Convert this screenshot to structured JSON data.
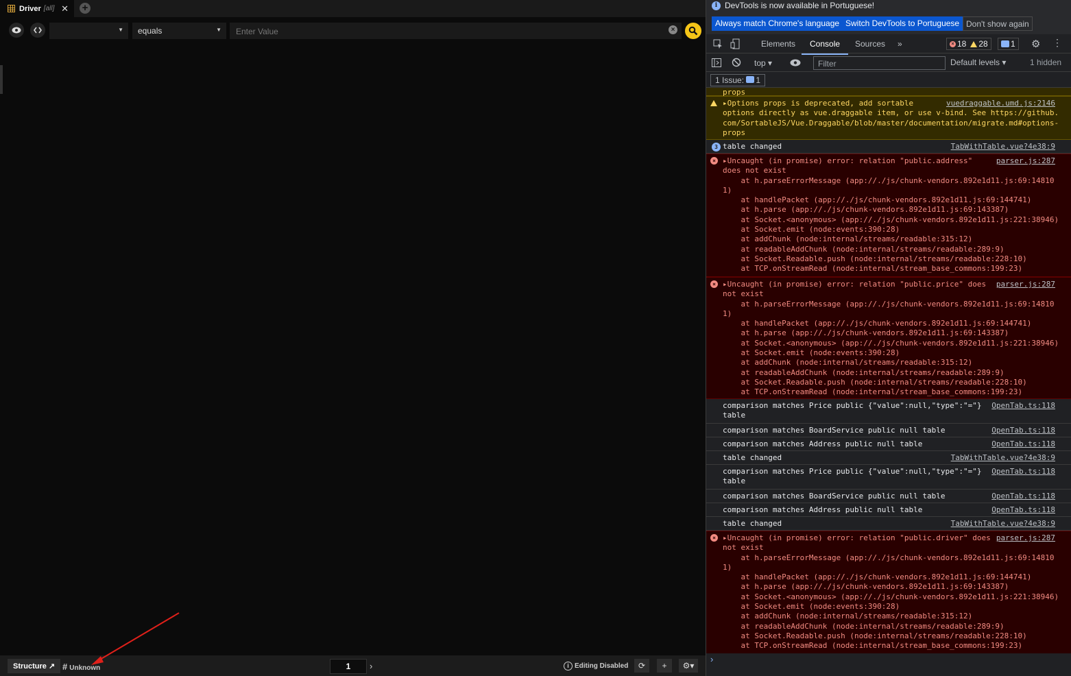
{
  "left": {
    "tab": {
      "title": "Driver",
      "scope": "[all]",
      "close": "✕",
      "add": "+"
    },
    "filter": {
      "column": "",
      "operator": "equals",
      "placeholder": "Enter Value"
    },
    "status": {
      "structure": "Structure ↗",
      "type": "Unknown",
      "page": "1",
      "editing": "Editing Disabled"
    }
  },
  "devtools": {
    "info": "DevTools is now available in Portuguese!",
    "btn_match": "Always match Chrome's language",
    "btn_switch": "Switch DevTools to Portuguese",
    "btn_dont": "Don't show again",
    "tabs": [
      "Elements",
      "Console",
      "Sources"
    ],
    "errors": "18",
    "warnings": "28",
    "messages": "1",
    "context": "top",
    "filter_placeholder": "Filter",
    "levels": "Default levels",
    "hidden": "1 hidden",
    "issues": "1 Issue:",
    "issues_count": "1",
    "rows": [
      {
        "kind": "warn-tail",
        "text": "props"
      },
      {
        "kind": "warn",
        "text": "▸Options props is deprecated, add sortable\noptions directly as vue.draggable item, or use v-bind. See https://github.\ncom/SortableJS/Vue.Draggable/blob/master/documentation/migrate.md#options-\nprops",
        "src": "vuedraggable.umd.js:2146"
      },
      {
        "kind": "log",
        "count": "3",
        "text": "table changed",
        "src": "TabWithTable.vue?4e38:9"
      },
      {
        "kind": "err",
        "text": "▸Uncaught (in promise) error: relation \"public.address\"\ndoes not exist\n    at h.parseErrorMessage (app://./js/chunk-vendors.892e1d11.js:69:14810\n1)\n    at handlePacket (app://./js/chunk-vendors.892e1d11.js:69:144741)\n    at h.parse (app://./js/chunk-vendors.892e1d11.js:69:143387)\n    at Socket.<anonymous> (app://./js/chunk-vendors.892e1d11.js:221:38946)\n    at Socket.emit (node:events:390:28)\n    at addChunk (node:internal/streams/readable:315:12)\n    at readableAddChunk (node:internal/streams/readable:289:9)\n    at Socket.Readable.push (node:internal/streams/readable:228:10)\n    at TCP.onStreamRead (node:internal/stream_base_commons:199:23)",
        "src": "parser.js:287"
      },
      {
        "kind": "err",
        "text": "▸Uncaught (in promise) error: relation \"public.price\" does\nnot exist\n    at h.parseErrorMessage (app://./js/chunk-vendors.892e1d11.js:69:14810\n1)\n    at handlePacket (app://./js/chunk-vendors.892e1d11.js:69:144741)\n    at h.parse (app://./js/chunk-vendors.892e1d11.js:69:143387)\n    at Socket.<anonymous> (app://./js/chunk-vendors.892e1d11.js:221:38946)\n    at Socket.emit (node:events:390:28)\n    at addChunk (node:internal/streams/readable:315:12)\n    at readableAddChunk (node:internal/streams/readable:289:9)\n    at Socket.Readable.push (node:internal/streams/readable:228:10)\n    at TCP.onStreamRead (node:internal/stream_base_commons:199:23)",
        "src": "parser.js:287"
      },
      {
        "kind": "log",
        "text": "comparison matches Price public {\"value\":null,\"type\":\"=\"}\ntable",
        "src": "OpenTab.ts:118"
      },
      {
        "kind": "log",
        "text": "comparison matches BoardService public null table",
        "src": "OpenTab.ts:118"
      },
      {
        "kind": "log",
        "text": "comparison matches Address public null table",
        "src": "OpenTab.ts:118"
      },
      {
        "kind": "log",
        "text": "table changed",
        "src": "TabWithTable.vue?4e38:9"
      },
      {
        "kind": "log",
        "text": "comparison matches Price public {\"value\":null,\"type\":\"=\"}\ntable",
        "src": "OpenTab.ts:118"
      },
      {
        "kind": "log",
        "text": "comparison matches BoardService public null table",
        "src": "OpenTab.ts:118"
      },
      {
        "kind": "log",
        "text": "comparison matches Address public null table",
        "src": "OpenTab.ts:118"
      },
      {
        "kind": "log",
        "text": "table changed",
        "src": "TabWithTable.vue?4e38:9"
      },
      {
        "kind": "err",
        "text": "▸Uncaught (in promise) error: relation \"public.driver\" does\nnot exist\n    at h.parseErrorMessage (app://./js/chunk-vendors.892e1d11.js:69:14810\n1)\n    at handlePacket (app://./js/chunk-vendors.892e1d11.js:69:144741)\n    at h.parse (app://./js/chunk-vendors.892e1d11.js:69:143387)\n    at Socket.<anonymous> (app://./js/chunk-vendors.892e1d11.js:221:38946)\n    at Socket.emit (node:events:390:28)\n    at addChunk (node:internal/streams/readable:315:12)\n    at readableAddChunk (node:internal/streams/readable:289:9)\n    at Socket.Readable.push (node:internal/streams/readable:228:10)\n    at TCP.onStreamRead (node:internal/stream_base_commons:199:23)",
        "src": "parser.js:287"
      }
    ],
    "prompt": "›"
  }
}
